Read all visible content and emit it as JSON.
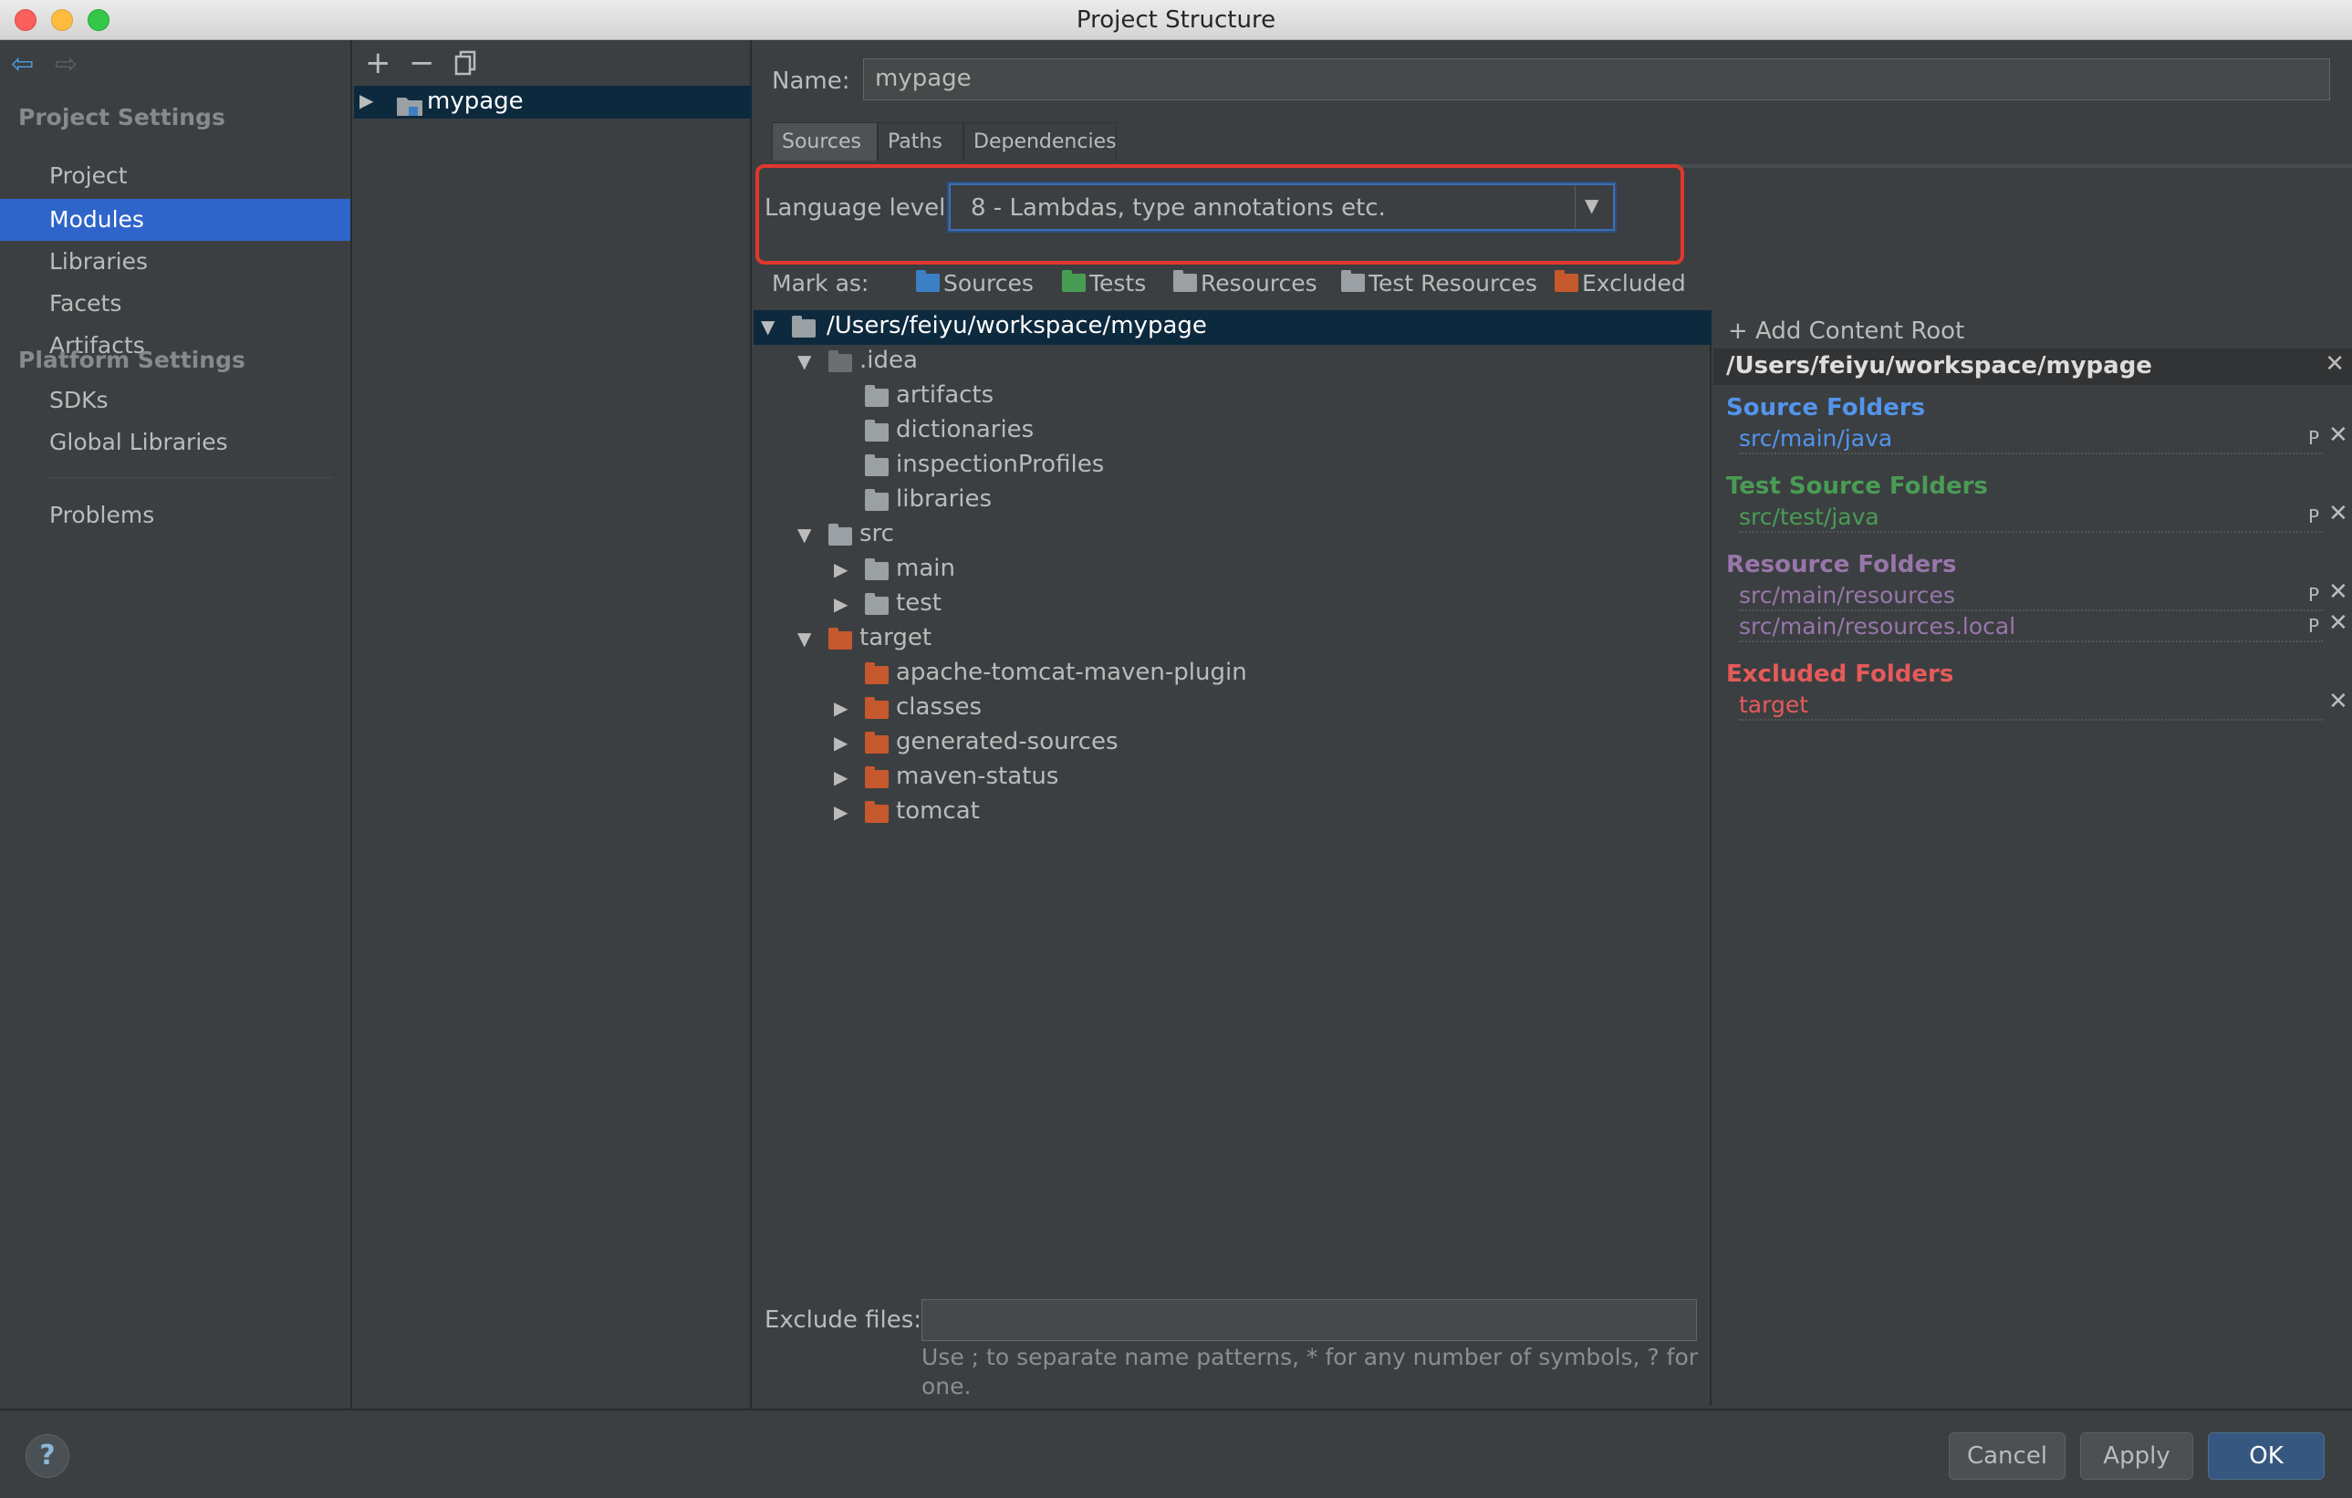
{
  "window": {
    "title": "Project Structure"
  },
  "nav": {
    "project_settings_header": "Project Settings",
    "project_items": [
      "Project",
      "Modules",
      "Libraries",
      "Facets",
      "Artifacts"
    ],
    "platform_settings_header": "Platform Settings",
    "platform_items": [
      "SDKs",
      "Global Libraries"
    ],
    "problems": "Problems",
    "selected": "Modules"
  },
  "modules": {
    "toolbar": {
      "add": "+",
      "remove": "−"
    },
    "items": [
      "mypage"
    ]
  },
  "module": {
    "name_label": "Name:",
    "name_value": "mypage",
    "tabs": [
      "Sources",
      "Paths",
      "Dependencies"
    ],
    "selected_tab": "Sources",
    "language_level_label": "Language level:",
    "language_level_value": "8 - Lambdas, type annotations etc.",
    "mark_as_label": "Mark as:",
    "mark_as": [
      {
        "label": "Sources",
        "color": "#3d7fc4"
      },
      {
        "label": "Tests",
        "color": "#499c54"
      },
      {
        "label": "Resources",
        "color": "#9aa0a3"
      },
      {
        "label": "Test Resources",
        "color": "#9aa0a3"
      },
      {
        "label": "Excluded",
        "color": "#c6582e"
      }
    ]
  },
  "tree": {
    "root": "/Users/feiyu/workspace/mypage",
    "rows": [
      {
        "label": ".idea",
        "expanded": true,
        "color": "dgrey"
      },
      {
        "label": "artifacts",
        "color": "grey"
      },
      {
        "label": "dictionaries",
        "color": "grey"
      },
      {
        "label": "inspectionProfiles",
        "color": "grey"
      },
      {
        "label": "libraries",
        "color": "grey"
      },
      {
        "label": "src",
        "expanded": true,
        "color": "grey"
      },
      {
        "label": "main",
        "expanded": false,
        "color": "grey"
      },
      {
        "label": "test",
        "expanded": false,
        "color": "grey"
      },
      {
        "label": "target",
        "expanded": true,
        "color": "orange"
      },
      {
        "label": "apache-tomcat-maven-plugin",
        "color": "orange"
      },
      {
        "label": "classes",
        "expanded": false,
        "color": "orange"
      },
      {
        "label": "generated-sources",
        "expanded": false,
        "color": "orange"
      },
      {
        "label": "maven-status",
        "expanded": false,
        "color": "orange"
      },
      {
        "label": "tomcat",
        "expanded": false,
        "color": "orange"
      }
    ]
  },
  "exclude": {
    "label": "Exclude files:",
    "value": "",
    "hint": "Use ; to separate name patterns, * for any number of symbols, ? for one."
  },
  "roots": {
    "add_label": "+ Add Content Root",
    "root_path": "/Users/feiyu/workspace/mypage",
    "source_header": "Source Folders",
    "source_items": [
      "src/main/java"
    ],
    "test_header": "Test Source Folders",
    "test_items": [
      "src/test/java"
    ],
    "resource_header": "Resource Folders",
    "resource_items": [
      "src/main/resources",
      "src/main/resources.local"
    ],
    "excluded_header": "Excluded Folders",
    "excluded_items": [
      "target"
    ],
    "colors": {
      "source": "#5394ec",
      "test": "#499c54",
      "resource": "#9876aa",
      "excluded": "#e65a5a"
    }
  },
  "buttons": {
    "help": "?",
    "cancel": "Cancel",
    "apply": "Apply",
    "ok": "OK"
  }
}
